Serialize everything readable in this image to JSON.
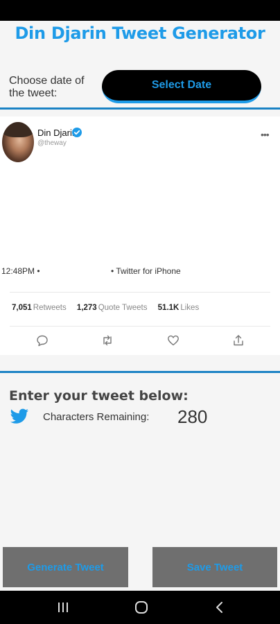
{
  "app": {
    "title": "Din Djarin Tweet Generator"
  },
  "date_picker": {
    "label": "Choose date of the tweet:",
    "button_label": "Select Date"
  },
  "tweet": {
    "user_name": "Din Djarin",
    "handle": "@theway",
    "time": "12:48PM •",
    "source": "• Twitter for iPhone",
    "stats": [
      {
        "count": "7,051",
        "label": "Retweets"
      },
      {
        "count": "1,273",
        "label": "Quote Tweets"
      },
      {
        "count": "51.1K",
        "label": "Likes"
      }
    ],
    "actions": [
      "reply-icon",
      "retweet-icon",
      "like-icon",
      "share-icon"
    ]
  },
  "composer": {
    "heading": "Enter your tweet below:",
    "chars_label": "Characters Remaining:",
    "chars_remaining": "280"
  },
  "buttons": {
    "generate": "Generate Tweet",
    "save": "Save Tweet"
  },
  "colors": {
    "accent": "#1e9be8",
    "divider": "#1a82c4",
    "button_bg": "#6f6f6f"
  }
}
